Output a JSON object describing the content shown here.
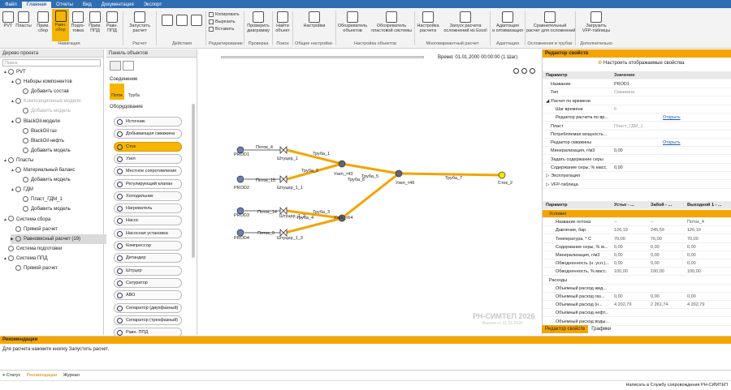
{
  "menu_tabs": [
    "Файл",
    "Главная",
    "Отчеты",
    "Вид",
    "Документация",
    "Экспорт"
  ],
  "ribbon": {
    "buttons": {
      "pvt": "PVT",
      "plasty": "Пласты",
      "prim_sbor": "Прим.\nсбор",
      "ravn_sbor": "Равн.\nсбор",
      "podgotovka": "Подго-\nтовка",
      "prim_ppd": "Прим.\nППД",
      "ravn_ppd": "Равн.\nППД",
      "run": "Запустить\nрасчет",
      "copy": "Копировать",
      "cut": "Вырезать",
      "paste": "Вставить",
      "check": "Проверить\nдиаграмму",
      "find": "Найти\nобъект",
      "settings": "Настройки",
      "obj_browser": "Обозреватель\nобъектов",
      "plast_browser": "Обозреватель\nпластовой системы",
      "calc_setup": "Настройка\nрасчета",
      "excel_run": "Запуск расчета\nосложнений из Excel",
      "adapt": "Адаптация\nи оптимизация",
      "compare": "Сравнительный\nрасчет для осложнений",
      "vfp": "Загрузить\nVFP-таблицы"
    },
    "groups": {
      "nav": "Навигация",
      "calc": "Расчет",
      "actions": "Действия",
      "edit": "Редактирование",
      "check": "Проверка",
      "search": "Поиск",
      "common": "Общие настройки",
      "obj_setup": "Настройка объектов",
      "multi": "Многовариантный расчет",
      "adapt": "Адаптация",
      "complic": "Осложнения в трубах",
      "extra": "Дополнительно"
    }
  },
  "left_pane": {
    "title": "Дерево проекта",
    "search_placeholder": "Поиск",
    "items": [
      {
        "label": "PVT",
        "level": 0,
        "arrow": "▲",
        "dim": false
      },
      {
        "label": "Наборы компонентов",
        "level": 1,
        "arrow": "▲",
        "dim": false
      },
      {
        "label": "Добавить состав",
        "level": 2,
        "arrow": "",
        "dim": false
      },
      {
        "label": "Композиционные модели",
        "level": 1,
        "arrow": "▲",
        "dim": true
      },
      {
        "label": "Добавить модель",
        "level": 2,
        "arrow": "",
        "dim": true
      },
      {
        "label": "BlackOil-модели",
        "level": 1,
        "arrow": "▲",
        "dim": false
      },
      {
        "label": "BlackOil газ",
        "level": 2,
        "arrow": "",
        "dim": false
      },
      {
        "label": "BlackOil нефть",
        "level": 2,
        "arrow": "",
        "dim": false
      },
      {
        "label": "Добавить модель",
        "level": 2,
        "arrow": "",
        "dim": false
      },
      {
        "label": "Пласты",
        "level": 0,
        "arrow": "▲",
        "dim": false
      },
      {
        "label": "Материальный баланс",
        "level": 1,
        "arrow": "▲",
        "dim": false
      },
      {
        "label": "Добавить модель",
        "level": 2,
        "arrow": "",
        "dim": false
      },
      {
        "label": "ГДМ",
        "level": 1,
        "arrow": "▲",
        "dim": false
      },
      {
        "label": "Пласт_ГДМ_1",
        "level": 2,
        "arrow": "",
        "dim": false
      },
      {
        "label": "Добавить модель",
        "level": 2,
        "arrow": "",
        "dim": false
      },
      {
        "label": "Система сбора",
        "level": 0,
        "arrow": "▲",
        "dim": false
      },
      {
        "label": "Прямой расчет",
        "level": 1,
        "arrow": "",
        "dim": false
      },
      {
        "label": "Равновесный расчет (19)",
        "level": 1,
        "arrow": "▶",
        "dim": false
      },
      {
        "label": "Система подготовки",
        "level": 0,
        "arrow": "",
        "dim": false
      },
      {
        "label": "Система ППД",
        "level": 0,
        "arrow": "▲",
        "dim": false
      },
      {
        "label": "Прямой расчет",
        "level": 1,
        "arrow": "",
        "dim": false
      }
    ]
  },
  "obj_pane": {
    "title": "Панель объектов",
    "connection": "Соединение",
    "flow": "Поток",
    "pipe": "Труба",
    "equipment": "Оборудование",
    "items": [
      "Источник",
      "Добывающая скважина",
      "Сток",
      "Узел",
      "Местное сопротивление",
      "Регулирующий клапан",
      "Холодильник",
      "Нагреватель",
      "Насос",
      "Насосная установка",
      "Компрессор",
      "Детандер",
      "Штуцер",
      "Сатуратор",
      "АВО",
      "Сепаратор (двухфазный)",
      "Сепаратор (трехфазный)",
      "Равн. ППД"
    ]
  },
  "canvas": {
    "time_label": "Время: 01.01.2000 00:00:00 (1 Шаг)",
    "watermark": "РН-СИМТЕП 2026",
    "watermark_sub": "Версия от 01.01.2026",
    "labels": {
      "prod1": "PROD1",
      "prod2": "PROD2",
      "prod3": "PROD3",
      "prod4": "PROD4",
      "potok4": "Поток_4",
      "potok15": "Поток_15",
      "potok14": "Поток_14",
      "potok9": "Поток_9",
      "sht1": "Штуцер_1",
      "sht1_1": "Штуцер_1_1",
      "sht1_2": "Штуцер_1_2",
      "sht1_3": "Штуцер_1_3",
      "truba1": "Труба_1",
      "truba2": "Труба_2",
      "truba3": "Труба_3",
      "truba4": "Труба_4",
      "truba5": "Труба_5",
      "truba6": "Труба_6",
      "truba7": "Труба_7",
      "uzel_t43": "Узел_т43",
      "uzel_t64": "Узел_т64",
      "uzel_t46": "Узел_т46",
      "stok2": "Сток_2"
    }
  },
  "right_pane": {
    "title": "Редактор свойств",
    "configure": "Настроить отображаемые свойства",
    "col_param": "Параметр",
    "col_value": "Значение",
    "props": [
      {
        "k": "Название",
        "v": "PROD1",
        "dim": false,
        "indent": 1
      },
      {
        "k": "Тип",
        "v": "Скважина",
        "dim": true,
        "indent": 1
      },
      {
        "k": "Расчет по времени",
        "v": "",
        "dim": false,
        "indent": 0,
        "arrow": "◢"
      },
      {
        "k": "Шаг времени",
        "v": "0",
        "dim": true,
        "indent": 2
      },
      {
        "k": "Редактор расчета по вр...",
        "v": "Открыть",
        "link": true,
        "indent": 2
      },
      {
        "k": "Пласт",
        "v": "Пласт_ГДМ_1",
        "dim": true,
        "indent": 1
      },
      {
        "k": "Потребляемая мощность...",
        "v": "",
        "dim": false,
        "indent": 1
      },
      {
        "k": "Редактор скважины",
        "v": "Открыть",
        "link": true,
        "indent": 1
      },
      {
        "k": "Минерализация, г/м3",
        "v": "0,00",
        "dim": false,
        "indent": 1
      },
      {
        "k": "Задать содержание серы",
        "v": "",
        "dim": false,
        "indent": 1
      },
      {
        "k": "Содержание серы, % масс.",
        "v": "0,00",
        "dim": false,
        "indent": 1
      },
      {
        "k": "Эксплуатация",
        "v": "",
        "dim": false,
        "indent": 0,
        "arrow": "▷"
      },
      {
        "k": "VFP-таблица",
        "v": "",
        "dim": false,
        "indent": 0,
        "arrow": "▷"
      }
    ],
    "table_headers": [
      "Параметр",
      "Устье - ...",
      "Забой - ...",
      "Выходной 1 - ..."
    ],
    "table_rows": [
      {
        "k": "Условия",
        "c1": "",
        "c2": "",
        "c3": "",
        "group": true,
        "sel": true
      },
      {
        "k": "Название потока",
        "c1": "--",
        "c2": "--",
        "c3": "Поток_4"
      },
      {
        "k": "Давление, бар",
        "c1": "126,19",
        "c2": "245,59",
        "c3": "126,19"
      },
      {
        "k": "Температура, ° С",
        "c1": "70,00",
        "c2": "76,00",
        "c3": "70,00"
      },
      {
        "k": "Содержание серы, % м...",
        "c1": "0,00",
        "c2": "0,00",
        "c3": "0,00"
      },
      {
        "k": "Минерализация, г/м3",
        "c1": "0,00",
        "c2": "0,00",
        "c3": "0,00"
      },
      {
        "k": "Обводненность (н. усл.)...",
        "c1": "0,00",
        "c2": "0,00",
        "c3": "0,00"
      },
      {
        "k": "Обводненность, % масс.",
        "c1": "100,00",
        "c2": "100,00",
        "c3": "100,00"
      },
      {
        "k": "Расходы",
        "c1": "",
        "c2": "",
        "c3": "",
        "group": true
      },
      {
        "k": "Объемный расход жид...",
        "c1": "",
        "c2": "",
        "c3": ""
      },
      {
        "k": "Объемный расход газ...",
        "c1": "0,00",
        "c2": "0,00",
        "c3": "0,00"
      },
      {
        "k": "Объемный расход (н...",
        "c1": "4 202,79",
        "c2": "2 261,74",
        "c3": "4 202,79"
      },
      {
        "k": "Объемный расход нефт...",
        "c1": "",
        "c2": "",
        "c3": ""
      },
      {
        "k": "Объемный расход воды...",
        "c1": "",
        "c2": "",
        "c3": ""
      }
    ],
    "tabs": [
      "Редактор свойств",
      "Графики"
    ]
  },
  "recom": {
    "title": "Рекомендации",
    "text": "Для расчета нажмите кнопку Запустить расчет."
  },
  "statusbar": {
    "status": "Статус",
    "recom": "Рекомендации",
    "journal": "Журнал"
  },
  "bottombar": {
    "support": "Написать в Службу сопровождения РН-СИМТЕП"
  }
}
